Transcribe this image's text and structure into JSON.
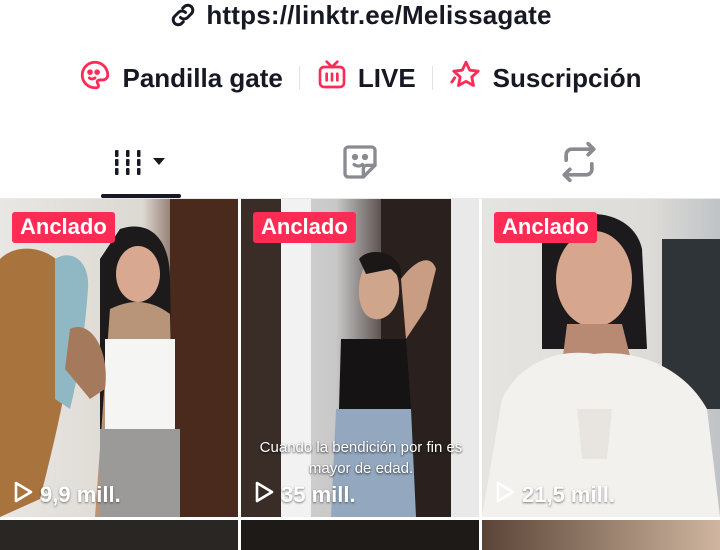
{
  "profile": {
    "link_text": "https://linktr.ee/Melissagate",
    "link_icon": "link-icon"
  },
  "chips": [
    {
      "label": "Pandilla gate",
      "icon": "emoji-face-icon",
      "icon_color": "#fe2c55"
    },
    {
      "label": "LIVE",
      "icon": "live-tv-icon",
      "icon_color": "#fe2c55"
    },
    {
      "label": "Suscripción",
      "icon": "star-icon",
      "icon_color": "#fe2c55"
    }
  ],
  "tabs": [
    {
      "name": "videos-tab",
      "icon": "grid-bars-icon",
      "active": true
    },
    {
      "name": "favorites-tab",
      "icon": "sticker-icon",
      "active": false
    },
    {
      "name": "reposts-tab",
      "icon": "repost-icon",
      "active": false
    }
  ],
  "videos": [
    {
      "badge": "Anclado",
      "views": "9,9 mill.",
      "caption": ""
    },
    {
      "badge": "Anclado",
      "views": "35 mill.",
      "caption": "Cuando la  bendición por fin es mayor de edad."
    },
    {
      "badge": "Anclado",
      "views": "21,5 mill.",
      "caption": ""
    }
  ],
  "colors": {
    "accent": "#fe2c55",
    "text": "#161823",
    "divider": "#e8e8ea"
  }
}
